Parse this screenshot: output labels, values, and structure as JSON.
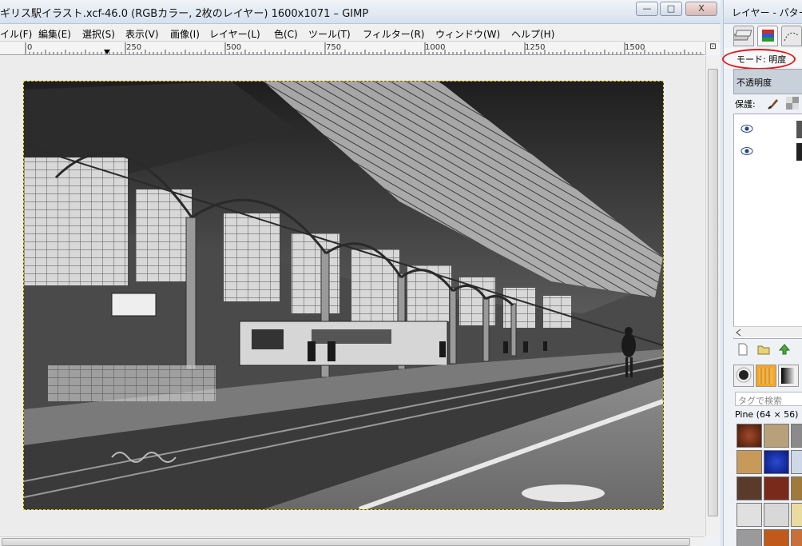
{
  "window": {
    "title": "ギリス駅イラスト.xcf-46.0 (RGBカラー, 2枚のレイヤー) 1600x1071 – GIMP",
    "minimize_glyph": "—",
    "maximize_glyph": "□",
    "close_glyph": "X"
  },
  "menu": [
    {
      "label": "イル(F)"
    },
    {
      "label": "編集(E)"
    },
    {
      "label": "選択(S)"
    },
    {
      "label": "表示(V)"
    },
    {
      "label": "画像(I)"
    },
    {
      "label": "レイヤー(L)"
    },
    {
      "label": "色(C)"
    },
    {
      "label": "ツール(T)"
    },
    {
      "label": "フィルター(R)"
    },
    {
      "label": "ウィンドウ(W)"
    },
    {
      "label": "ヘルプ(H)"
    }
  ],
  "ruler": {
    "labels": [
      "0",
      "250",
      "500",
      "750",
      "1000",
      "1250",
      "1500"
    ]
  },
  "dock": {
    "title": "レイヤー - パター",
    "mode_label": "モード: 明度",
    "opacity_label": "不透明度",
    "lock_label": "保護:",
    "layers": [
      {
        "visible": true
      },
      {
        "visible": true
      }
    ],
    "tag_search_placeholder": "タグで検索",
    "pattern_name": "Pine (64 × 56)"
  },
  "colors": {
    "annotation_ellipse": "#e0191b",
    "selection_border": "#e5d300",
    "titlebar_gradient_top": "#f1f4f8",
    "titlebar_gradient_bottom": "#d6e1ee"
  }
}
